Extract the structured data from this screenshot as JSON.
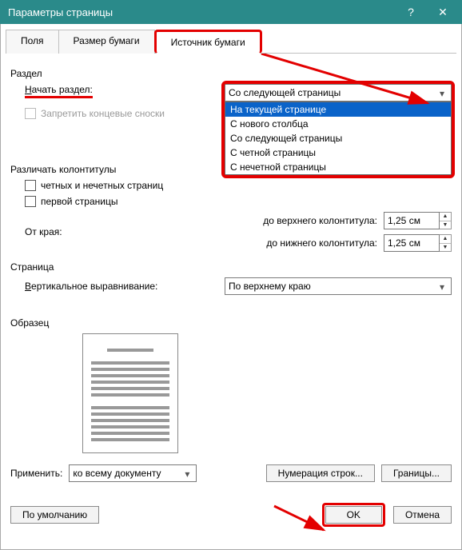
{
  "titlebar": {
    "title": "Параметры страницы"
  },
  "tabs": {
    "fields": "Поля",
    "paper_size": "Размер бумаги",
    "paper_source": "Источник бумаги"
  },
  "section": {
    "group": "Раздел",
    "start_label_u": "Н",
    "start_label_rest": "ачать раздел:",
    "start_value": "Со следующей страницы",
    "options": [
      "На текущей странице",
      "С нового столбца",
      "Со следующей страницы",
      "С четной страницы",
      "С нечетной страницы"
    ],
    "suppress_endnotes": "Запретить концевые сноски"
  },
  "headers": {
    "group": "Различать колонтитулы",
    "odd_even": "четных и нечетных страниц",
    "first_page": "первой страницы",
    "from_edge": "От края:",
    "to_header": "до верхнего колонтитула:",
    "to_footer": "до нижнего колонтитула:",
    "header_val": "1,25 см",
    "footer_val": "1,25 см"
  },
  "page": {
    "group": "Страница",
    "valign_label_u": "В",
    "valign_label_rest": "ертикальное выравнивание:",
    "valign_value": "По верхнему краю"
  },
  "preview": {
    "group": "Образец"
  },
  "apply": {
    "label": "Применить:",
    "value": "ко всему документу",
    "line_numbers": "Нумерация строк...",
    "borders": "Границы..."
  },
  "footer": {
    "default": "По умолчанию",
    "ok": "OK",
    "cancel": "Отмена"
  }
}
